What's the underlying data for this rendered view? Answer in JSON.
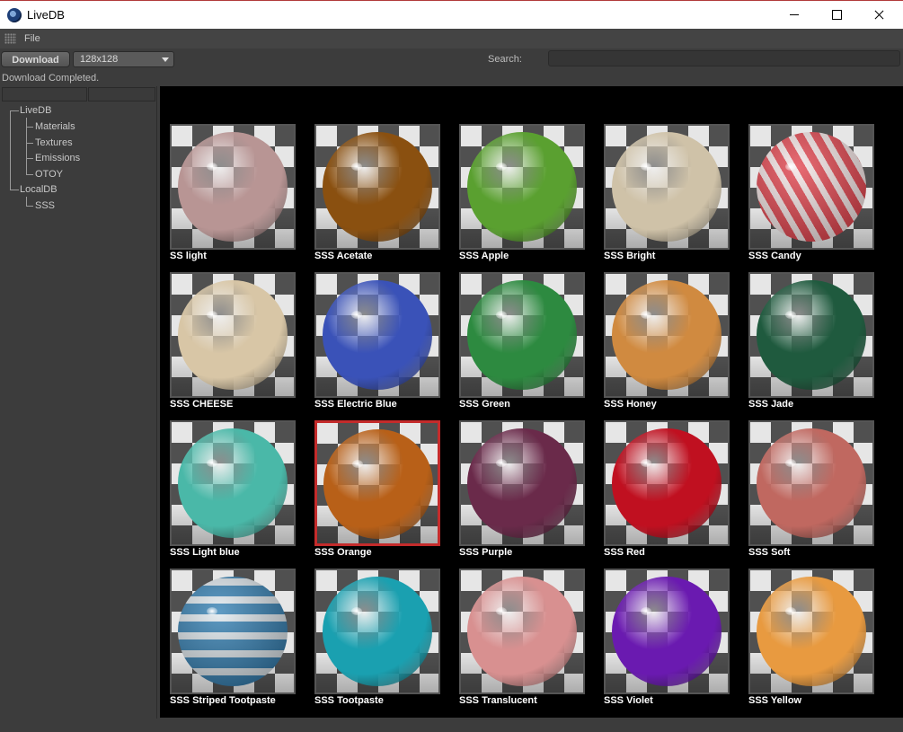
{
  "window": {
    "title": "LiveDB",
    "minimize_glyph": "",
    "maximize_glyph": "",
    "close_glyph": ""
  },
  "menu": {
    "file": "File"
  },
  "toolbar": {
    "download_label": "Download",
    "size_value": "128x128",
    "search_label": "Search:",
    "search_value": ""
  },
  "status": "Download Completed.",
  "tree": {
    "root1": "LiveDB",
    "children1": [
      "Materials",
      "Textures",
      "Emissions",
      "OTOY"
    ],
    "root2": "LocalDB",
    "children2": [
      "SSS"
    ]
  },
  "materials": [
    {
      "name": "SS light",
      "color": "#b89594"
    },
    {
      "name": "SSS Acetate",
      "color": "#8a5010"
    },
    {
      "name": "SSS Apple",
      "color": "#5aa030"
    },
    {
      "name": "SSS Bright",
      "color": "#cfc2a8"
    },
    {
      "name": "SSS Candy",
      "color": "#d83040"
    },
    {
      "name": "SSS CHEESE",
      "color": "#d8c6a6"
    },
    {
      "name": "SSS Electric Blue",
      "color": "#3a52b8"
    },
    {
      "name": "SSS Green",
      "color": "#2d8a40"
    },
    {
      "name": "SSS Honey",
      "color": "#d08a40"
    },
    {
      "name": "SSS Jade",
      "color": "#1f5a3e"
    },
    {
      "name": "SSS Light blue",
      "color": "#4ab8a8"
    },
    {
      "name": "SSS Orange",
      "color": "#b86018"
    },
    {
      "name": "SSS Purple",
      "color": "#6a2a4a"
    },
    {
      "name": "SSS Red",
      "color": "#c01020"
    },
    {
      "name": "SSS Soft",
      "color": "#c06860"
    },
    {
      "name": "SSS Striped Tootpaste",
      "color": "#2a7ab0"
    },
    {
      "name": "SSS Tootpaste",
      "color": "#1aa0b0"
    },
    {
      "name": "SSS Translucent",
      "color": "#d89090"
    },
    {
      "name": "SSS Violet",
      "color": "#6a1ab0"
    },
    {
      "name": "SSS Yellow",
      "color": "#e89a40"
    }
  ],
  "selected_material": "SSS Orange"
}
